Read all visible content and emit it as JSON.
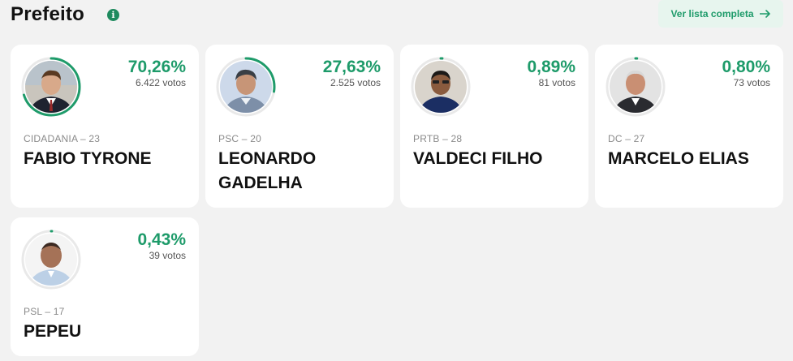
{
  "header": {
    "title": "Prefeito",
    "info_icon": "info-icon",
    "view_all_label": "Ver lista completa",
    "view_all_icon": "arrow-right-icon"
  },
  "colors": {
    "accent": "#1e9b6a",
    "ring_track": "#e9e9e9",
    "background": "#f2f2f2",
    "card": "#ffffff"
  },
  "candidates": [
    {
      "percent_label": "70,26%",
      "percent_value": 70.26,
      "votes": "6.422 votos",
      "party": "CIDADANIA – 23",
      "name": "FABIO TYRONE"
    },
    {
      "percent_label": "27,63%",
      "percent_value": 27.63,
      "votes": "2.525 votos",
      "party": "PSC – 20",
      "name": "LEONARDO GADELHA"
    },
    {
      "percent_label": "0,89%",
      "percent_value": 0.89,
      "votes": "81 votos",
      "party": "PRTB – 28",
      "name": "VALDECI FILHO"
    },
    {
      "percent_label": "0,80%",
      "percent_value": 0.8,
      "votes": "73 votos",
      "party": "DC – 27",
      "name": "MARCELO ELIAS"
    },
    {
      "percent_label": "0,43%",
      "percent_value": 0.43,
      "votes": "39 votos",
      "party": "PSL – 17",
      "name": "PEPEU"
    }
  ]
}
